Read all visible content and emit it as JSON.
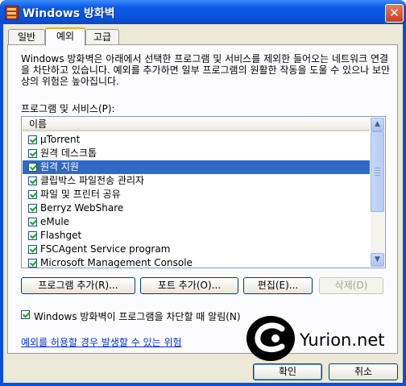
{
  "window": {
    "title": "Windows 방화벽"
  },
  "tabs": [
    {
      "label": "일반",
      "active": false
    },
    {
      "label": "예외",
      "active": true
    },
    {
      "label": "고급",
      "active": false
    }
  ],
  "description": "Windows 방화벽은 아래에서 선택한 프로그램 및 서비스를 제외한 들어오는 네트워크 연결을 차단하고 있습니다. 예외를 추가하면 일부 프로그램의 원활한 작동을 도울 수 있으나 보안상의 위험은 높아집니다.",
  "list": {
    "label": "프로그램 및 서비스(P):",
    "column_header": "이름",
    "items": [
      {
        "label": "µTorrent",
        "checked": true,
        "selected": false
      },
      {
        "label": "원격 데스크톱",
        "checked": true,
        "selected": false
      },
      {
        "label": "원격 지원",
        "checked": true,
        "selected": true
      },
      {
        "label": "클립박스 파일전송 관리자",
        "checked": true,
        "selected": false
      },
      {
        "label": "파일 및 프린터 공유",
        "checked": true,
        "selected": false
      },
      {
        "label": "Berryz WebShare",
        "checked": true,
        "selected": false
      },
      {
        "label": "eMule",
        "checked": true,
        "selected": false
      },
      {
        "label": "Flashget",
        "checked": true,
        "selected": false
      },
      {
        "label": "FSCAgent Service program",
        "checked": true,
        "selected": false
      },
      {
        "label": "Microsoft Management Console",
        "checked": true,
        "selected": false
      }
    ]
  },
  "buttons": {
    "add_program": "프로그램 추가(R)...",
    "add_port": "포트 추가(O)...",
    "edit": "편집(E)...",
    "delete": "삭제(D)",
    "ok": "확인",
    "cancel": "취소"
  },
  "notify": {
    "label": "Windows 방화벽이 프로그램을 차단할 때 알림(N)",
    "checked": true
  },
  "risk_link": "예외를 허용할 경우 발생할 수 있는 위험",
  "watermark": {
    "text": "Yurion.net"
  },
  "colors": {
    "titlebar": "#0a5ae8",
    "selection": "#316ac5",
    "dialog": "#ece9d8",
    "link": "#0033cc"
  }
}
